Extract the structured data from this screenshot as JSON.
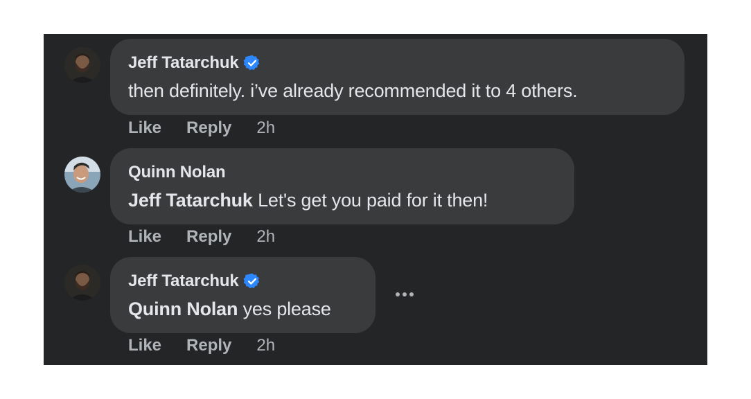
{
  "comments": [
    {
      "author": "Jeff Tatarchuk",
      "verified": true,
      "mention": "",
      "text": "then definitely. i’ve already recommended it to 4 others.",
      "like_label": "Like",
      "reply_label": "Reply",
      "time": "2h",
      "avatar_icon": "profile-photo-bearded-man"
    },
    {
      "author": "Quinn Nolan",
      "verified": false,
      "mention": "Jeff Tatarchuk",
      "text": " Let's get you paid for it then!",
      "like_label": "Like",
      "reply_label": "Reply",
      "time": "2h",
      "avatar_icon": "profile-photo-smiling-man"
    },
    {
      "author": "Jeff Tatarchuk",
      "verified": true,
      "mention": "Quinn Nolan",
      "text": " yes please",
      "like_label": "Like",
      "reply_label": "Reply",
      "time": "2h",
      "avatar_icon": "profile-photo-bearded-man",
      "more_icon": "more-options-icon"
    }
  ],
  "colors": {
    "background": "#242526",
    "bubble": "#3a3b3c",
    "text": "#e4e6eb",
    "secondary": "#b0b3b8",
    "verified": "#2d88ff"
  }
}
